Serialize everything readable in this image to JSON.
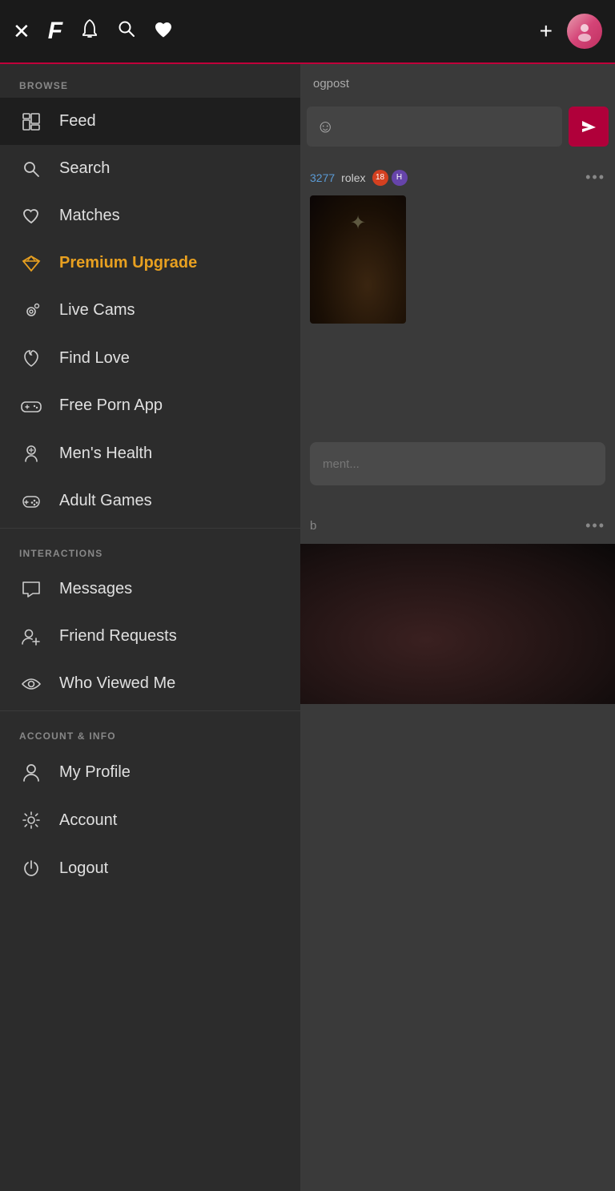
{
  "header": {
    "close_label": "✕",
    "logo_label": "F",
    "notification_label": "🔔",
    "search_label": "🔍",
    "heart_label": "♥",
    "plus_label": "+",
    "avatar_label": "👤"
  },
  "sidebar": {
    "browse_section_label": "BROWSE",
    "interactions_section_label": "INTERACTIONS",
    "account_section_label": "ACCOUNT & INFO",
    "items_browse": [
      {
        "id": "feed",
        "label": "Feed",
        "icon": "feed"
      },
      {
        "id": "search",
        "label": "Search",
        "icon": "search"
      },
      {
        "id": "matches",
        "label": "Matches",
        "icon": "heart"
      },
      {
        "id": "premium",
        "label": "Premium Upgrade",
        "icon": "diamond",
        "highlight": true
      },
      {
        "id": "livecams",
        "label": "Live Cams",
        "icon": "camera"
      },
      {
        "id": "findlove",
        "label": "Find Love",
        "icon": "flame"
      },
      {
        "id": "freeporn",
        "label": "Free Porn App",
        "icon": "gamepad"
      },
      {
        "id": "menshealth",
        "label": "Men's Health",
        "icon": "health"
      },
      {
        "id": "adultgames",
        "label": "Adult Games",
        "icon": "controller"
      }
    ],
    "items_interactions": [
      {
        "id": "messages",
        "label": "Messages",
        "icon": "chat"
      },
      {
        "id": "friendrequests",
        "label": "Friend Requests",
        "icon": "adduser"
      },
      {
        "id": "whoviewedme",
        "label": "Who Viewed Me",
        "icon": "eye"
      }
    ],
    "items_account": [
      {
        "id": "myprofile",
        "label": "My Profile",
        "icon": "person"
      },
      {
        "id": "account",
        "label": "Account",
        "icon": "gear"
      },
      {
        "id": "logout",
        "label": "Logout",
        "icon": "power"
      }
    ]
  },
  "content": {
    "blogpost_label": "ogpost",
    "comment_placeholder": "ment...",
    "post_user_num": "3277",
    "post_username": "rolex",
    "more_options": "•••"
  }
}
